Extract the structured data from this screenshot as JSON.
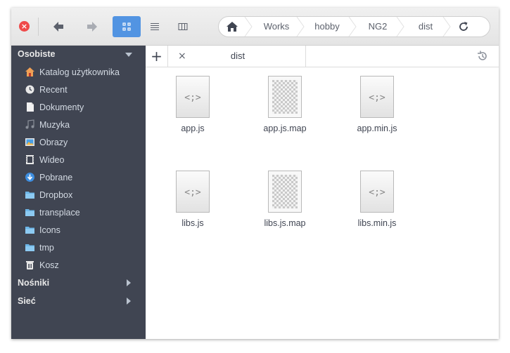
{
  "header": {
    "close_glyph": "×",
    "breadcrumbs": [
      "Works",
      "hobby",
      "NG2",
      "dist"
    ]
  },
  "sidebar": {
    "sections": {
      "personal": "Osobiste",
      "devices": "Nośniki",
      "network": "Sieć"
    },
    "items": [
      {
        "label": "Katalog użytkownika",
        "icon": "home-icon"
      },
      {
        "label": "Recent",
        "icon": "clock-icon"
      },
      {
        "label": "Dokumenty",
        "icon": "document-icon"
      },
      {
        "label": "Muzyka",
        "icon": "music-icon"
      },
      {
        "label": "Obrazy",
        "icon": "pictures-icon"
      },
      {
        "label": "Wideo",
        "icon": "video-icon"
      },
      {
        "label": "Pobrane",
        "icon": "download-icon"
      },
      {
        "label": "Dropbox",
        "icon": "folder-icon"
      },
      {
        "label": "transplace",
        "icon": "folder-icon"
      },
      {
        "label": "Icons",
        "icon": "folder-icon"
      },
      {
        "label": "tmp",
        "icon": "folder-icon"
      },
      {
        "label": "Kosz",
        "icon": "trash-icon"
      }
    ]
  },
  "tabs": {
    "new_tab_glyph": "+",
    "close_glyph": "×",
    "active_label": "dist"
  },
  "files": [
    {
      "name": "app.js",
      "type": "script"
    },
    {
      "name": "app.js.map",
      "type": "unknown"
    },
    {
      "name": "app.min.js",
      "type": "script"
    },
    {
      "name": "libs.js",
      "type": "script"
    },
    {
      "name": "libs.js.map",
      "type": "unknown"
    },
    {
      "name": "libs.min.js",
      "type": "script"
    }
  ],
  "colors": {
    "accent": "#5294e2",
    "sidebar_bg": "#404552",
    "close_button": "#ef4a4a"
  }
}
